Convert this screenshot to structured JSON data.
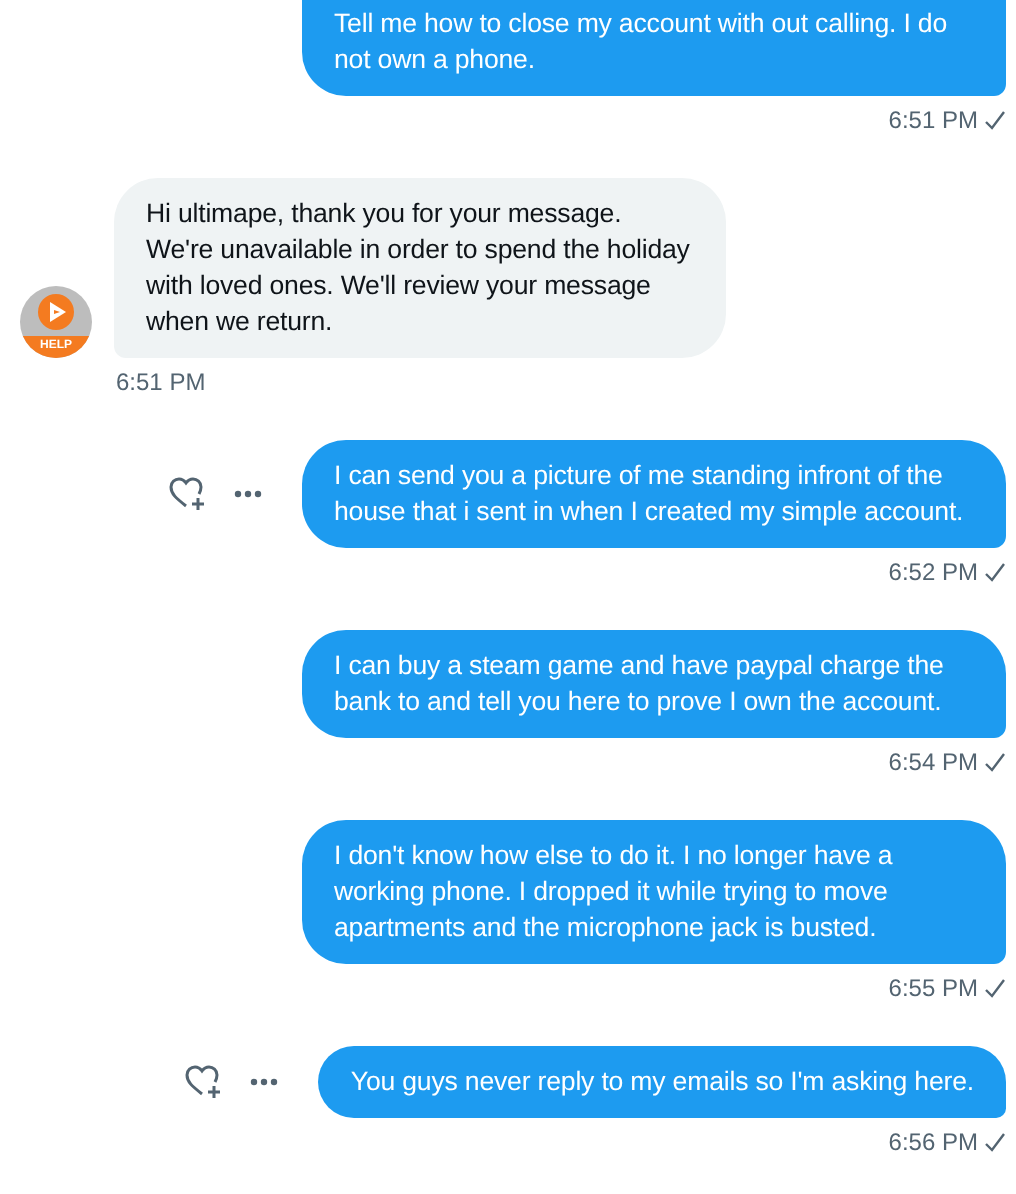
{
  "messages": [
    {
      "kind": "sent",
      "text": "Tell me how to close my account with out calling. I do not own a phone.",
      "time": "6:51 PM",
      "read": true,
      "actions": false
    },
    {
      "kind": "received",
      "text": "Hi ultimape, thank you for your message. We're unavailable in order to spend the holiday with loved ones. We'll review your message when we return.",
      "time": "6:51 PM",
      "avatar_badge": "HELP"
    },
    {
      "kind": "sent",
      "text": "I can send you a picture of me standing infront of the house that i sent in when I created my simple account.",
      "time": "6:52 PM",
      "read": true,
      "actions": true
    },
    {
      "kind": "sent",
      "text": "I can buy a steam game and have paypal charge the bank to and tell you here to prove I own the account.",
      "time": "6:54 PM",
      "read": true,
      "actions": false
    },
    {
      "kind": "sent",
      "text": "I don't know how else to do it. I no longer have a working phone. I dropped it while trying to move apartments and the microphone jack is busted.",
      "time": "6:55 PM",
      "read": true,
      "actions": false
    },
    {
      "kind": "sent",
      "text": "You guys never reply to my emails so I'm asking here.",
      "time": "6:56 PM",
      "read": true,
      "actions": true
    }
  ]
}
